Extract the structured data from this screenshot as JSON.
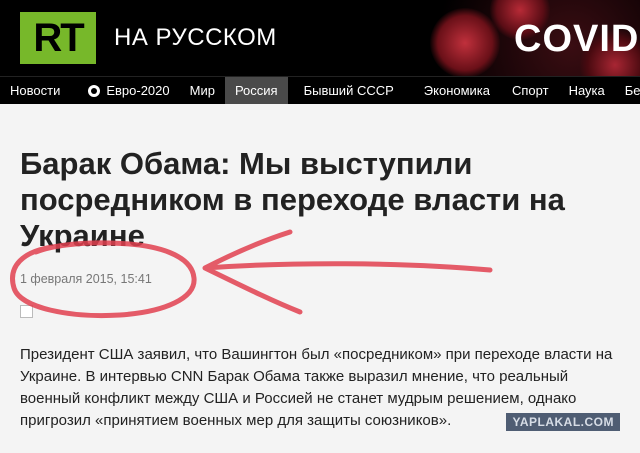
{
  "header": {
    "logo_text": "RT",
    "site_name": "НА РУССКОМ",
    "banner_text": "COVID-"
  },
  "nav": {
    "items": [
      {
        "label": "Новости",
        "active": false
      },
      {
        "label": "Евро-2020",
        "active": false,
        "icon": "soccer-ball-icon"
      },
      {
        "label": "Мир",
        "active": false
      },
      {
        "label": "Россия",
        "active": true
      },
      {
        "label": "Бывший СССР",
        "active": false
      },
      {
        "label": "Экономика",
        "active": false
      },
      {
        "label": "Спорт",
        "active": false
      },
      {
        "label": "Наука",
        "active": false
      },
      {
        "label": "Бе",
        "active": false
      }
    ]
  },
  "article": {
    "title": "Барак Обама: Мы выступили посредником в переходе власти на Украине",
    "date": "1 февраля 2015, 15:41",
    "lead": "Президент США заявил, что Вашингтон был «посредником» при переходе власти на Украине. В интервью CNN Барак Обама также выразил мнение, что реальный военный конфликт между США и Россией не станет мудрым решением, однако пригрозил «принятием военных мер для защиты союзников»."
  },
  "watermark": "YAPLAKAL.COM",
  "colors": {
    "logo_green": "#77b82a",
    "active_nav": "#4a4a4a",
    "annotation_red": "#e0404f"
  }
}
